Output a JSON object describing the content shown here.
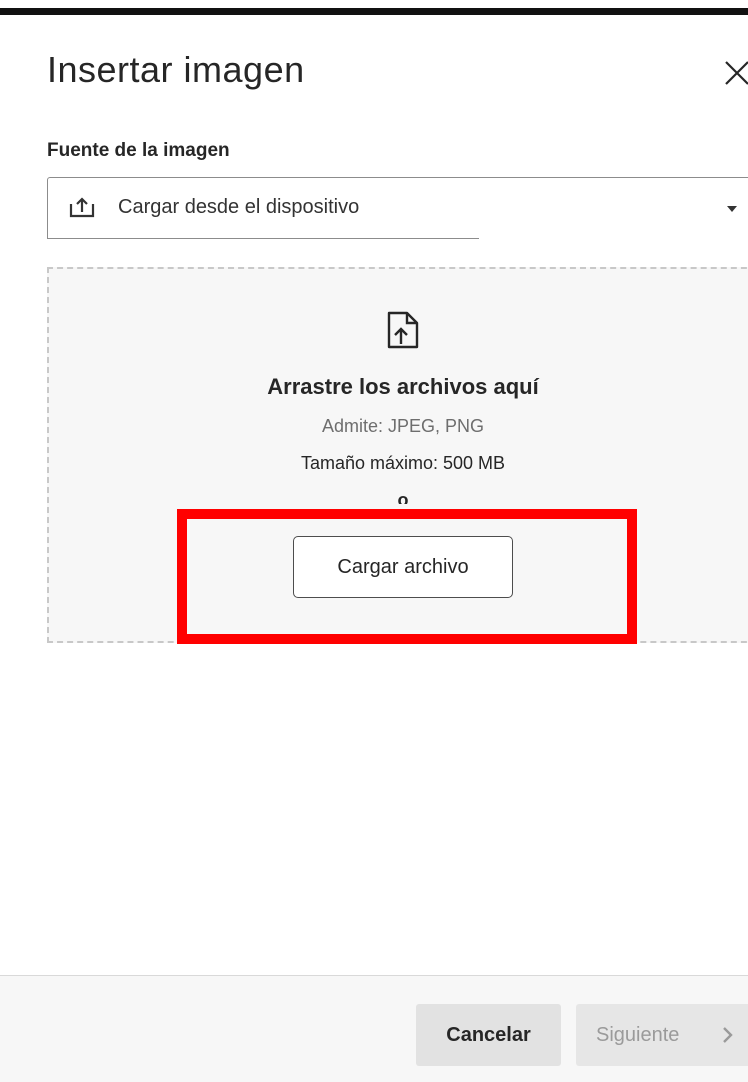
{
  "dialog": {
    "title": "Insertar imagen"
  },
  "source": {
    "label": "Fuente de la imagen",
    "selected_value": "Cargar desde el dispositivo"
  },
  "dropzone": {
    "title": "Arrastre los archivos aquí",
    "formats": "Admite: JPEG, PNG",
    "max_size": "Tamaño máximo: 500 MB",
    "or": "o",
    "upload_button": "Cargar archivo"
  },
  "footer": {
    "cancel_label": "Cancelar",
    "next_label": "Siguiente"
  },
  "colors": {
    "highlight": "#ff0000",
    "dropzone_background": "#f7f7f7",
    "text": "#262626"
  }
}
